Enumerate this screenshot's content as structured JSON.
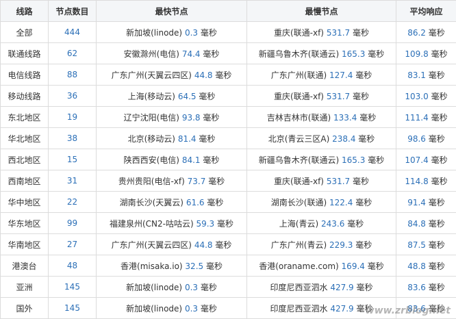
{
  "header": {
    "col_route": "线路",
    "col_nodes": "节点数目",
    "col_fastest": "最快节点",
    "col_slowest": "最慢节点",
    "col_avg": "平均响应"
  },
  "rows": [
    {
      "route": "全部",
      "nodes": "444",
      "fast_name": "新加坡(linode)",
      "fast_val": "0.3",
      "slow_name": "重庆(联通-xf)",
      "slow_val": "531.7",
      "avg": "86.2"
    },
    {
      "route": "联通线路",
      "nodes": "62",
      "fast_name": "安徽滁州(电信)",
      "fast_val": "74.4",
      "slow_name": "新疆乌鲁木齐(联通云)",
      "slow_val": "165.3",
      "avg": "109.8"
    },
    {
      "route": "电信线路",
      "nodes": "88",
      "fast_name": "广东广州(天翼云四区)",
      "fast_val": "44.8",
      "slow_name": "广东广州(联通)",
      "slow_val": "127.4",
      "avg": "83.1"
    },
    {
      "route": "移动线路",
      "nodes": "36",
      "fast_name": "上海(移动云)",
      "fast_val": "64.5",
      "slow_name": "重庆(联通-xf)",
      "slow_val": "531.7",
      "avg": "103.0"
    },
    {
      "route": "东北地区",
      "nodes": "19",
      "fast_name": "辽宁沈阳(电信)",
      "fast_val": "93.8",
      "slow_name": "吉林吉林市(联通)",
      "slow_val": "133.4",
      "avg": "111.4"
    },
    {
      "route": "华北地区",
      "nodes": "38",
      "fast_name": "北京(移动云)",
      "fast_val": "81.4",
      "slow_name": "北京(青云三区A)",
      "slow_val": "238.4",
      "avg": "98.6"
    },
    {
      "route": "西北地区",
      "nodes": "15",
      "fast_name": "陕西西安(电信)",
      "fast_val": "84.1",
      "slow_name": "新疆乌鲁木齐(联通云)",
      "slow_val": "165.3",
      "avg": "107.4"
    },
    {
      "route": "西南地区",
      "nodes": "31",
      "fast_name": "贵州贵阳(电信-xf)",
      "fast_val": "73.7",
      "slow_name": "重庆(联通-xf)",
      "slow_val": "531.7",
      "avg": "114.8"
    },
    {
      "route": "华中地区",
      "nodes": "22",
      "fast_name": "湖南长沙(天翼云)",
      "fast_val": "61.6",
      "slow_name": "湖南长沙(联通)",
      "slow_val": "122.4",
      "avg": "91.4"
    },
    {
      "route": "华东地区",
      "nodes": "99",
      "fast_name": "福建泉州(CN2-咕咕云)",
      "fast_val": "59.3",
      "slow_name": "上海(青云)",
      "slow_val": "243.6",
      "avg": "84.8"
    },
    {
      "route": "华南地区",
      "nodes": "27",
      "fast_name": "广东广州(天翼云四区)",
      "fast_val": "44.8",
      "slow_name": "广东广州(青云)",
      "slow_val": "229.3",
      "avg": "87.5"
    },
    {
      "route": "港澳台",
      "nodes": "48",
      "fast_name": "香港(misaka.io)",
      "fast_val": "32.5",
      "slow_name": "香港(oraname.com)",
      "slow_val": "169.4",
      "avg": "48.8"
    },
    {
      "route": "亚洲",
      "nodes": "145",
      "fast_name": "新加坡(linode)",
      "fast_val": "0.3",
      "slow_name": "印度尼西亚泗水",
      "slow_val": "427.9",
      "avg": "83.6"
    },
    {
      "route": "国外",
      "nodes": "145",
      "fast_name": "新加坡(linode)",
      "fast_val": "0.3",
      "slow_name": "印度尼西亚泗水",
      "slow_val": "427.9",
      "avg": "83.6"
    }
  ],
  "unit": "毫秒",
  "watermark": "www.zrblog.net",
  "colors": {
    "value_blue": "#2b6fb7",
    "header_bg": "#f4f6f8",
    "border": "#dcdcdc"
  }
}
